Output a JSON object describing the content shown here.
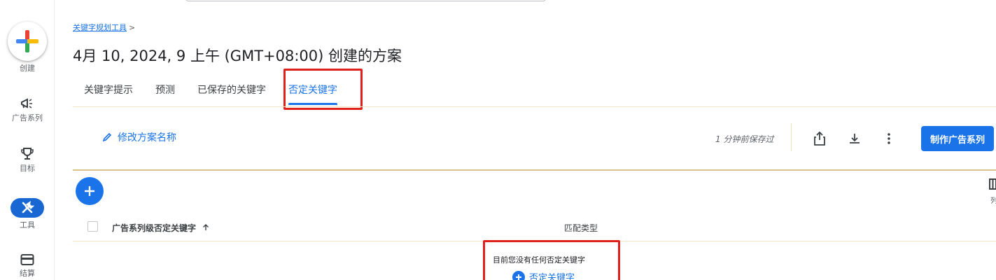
{
  "rail": {
    "create_label": "创建",
    "campaigns_label": "广告系列",
    "goals_label": "目标",
    "tools_label": "工具",
    "billing_label": "结算"
  },
  "breadcrumb": {
    "link": "关键字规划工具",
    "separator": ">"
  },
  "page": {
    "title": "4月 10, 2024, 9 上午 (GMT+08:00) 创建的方案"
  },
  "tabs": [
    {
      "label": "关键字提示"
    },
    {
      "label": "预测"
    },
    {
      "label": "已保存的关键字"
    },
    {
      "label": "否定关键字",
      "active": true
    }
  ],
  "toolbar": {
    "rename_label": "修改方案名称",
    "saved_status": "1 分钟前保存过",
    "create_campaign_label": "制作广告系列"
  },
  "table": {
    "columns": [
      {
        "label": "广告系列级否定关键字",
        "sorted": "asc"
      },
      {
        "label": "匹配类型"
      }
    ],
    "columns_control_label": "列"
  },
  "empty_state": {
    "message": "目前您没有任何否定关键字",
    "add_link": "否定关键字"
  },
  "colors": {
    "accent": "#1a73e8",
    "highlight": "#e0201b"
  }
}
